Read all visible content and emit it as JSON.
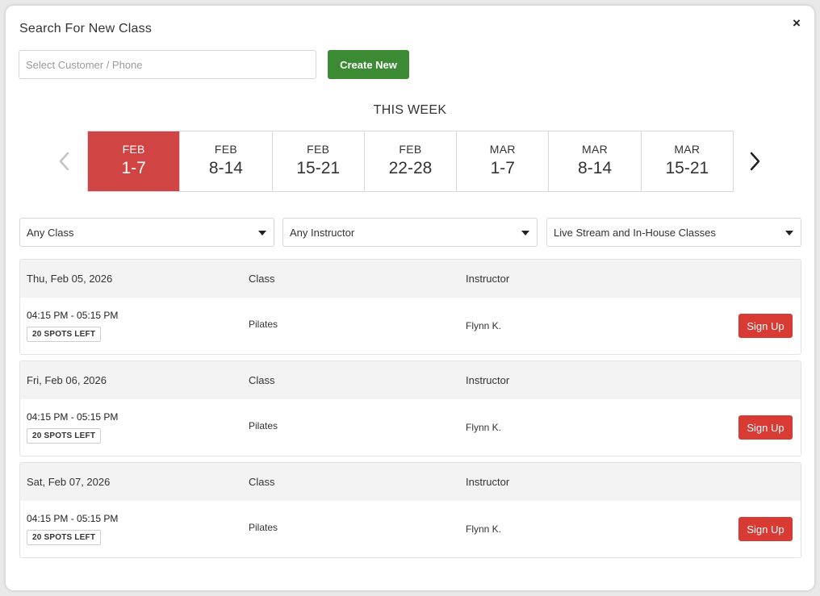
{
  "colors": {
    "green": "#3d8a35",
    "red_active": "#d04443",
    "red": "#d73b34"
  },
  "modal": {
    "title": "Search For New Class",
    "close_label": "×"
  },
  "customer": {
    "placeholder": "Select Customer / Phone",
    "value": ""
  },
  "create_button": "Create New",
  "week_label": "THIS WEEK",
  "nav": {
    "prev_icon": "chevron-left-icon",
    "next_icon": "chevron-right-icon"
  },
  "weeks": [
    {
      "month": "FEB",
      "range": "1-7",
      "active": true
    },
    {
      "month": "FEB",
      "range": "8-14",
      "active": false
    },
    {
      "month": "FEB",
      "range": "15-21",
      "active": false
    },
    {
      "month": "FEB",
      "range": "22-28",
      "active": false
    },
    {
      "month": "MAR",
      "range": "1-7",
      "active": false
    },
    {
      "month": "MAR",
      "range": "8-14",
      "active": false
    },
    {
      "month": "MAR",
      "range": "15-21",
      "active": false
    }
  ],
  "filters": {
    "class": "Any Class",
    "instructor": "Any Instructor",
    "type": "Live Stream and In-House Classes"
  },
  "column_headers": {
    "class": "Class",
    "instructor": "Instructor"
  },
  "days": [
    {
      "date": "Thu, Feb 05, 2026",
      "time": "04:15 PM - 05:15 PM",
      "spots": "20 SPOTS LEFT",
      "class": "Pilates",
      "instructor": "Flynn K.",
      "action": "Sign Up"
    },
    {
      "date": "Fri, Feb 06, 2026",
      "time": "04:15 PM - 05:15 PM",
      "spots": "20 SPOTS LEFT",
      "class": "Pilates",
      "instructor": "Flynn K.",
      "action": "Sign Up"
    },
    {
      "date": "Sat, Feb 07, 2026",
      "time": "04:15 PM - 05:15 PM",
      "spots": "20 SPOTS LEFT",
      "class": "Pilates",
      "instructor": "Flynn K.",
      "action": "Sign Up"
    }
  ]
}
